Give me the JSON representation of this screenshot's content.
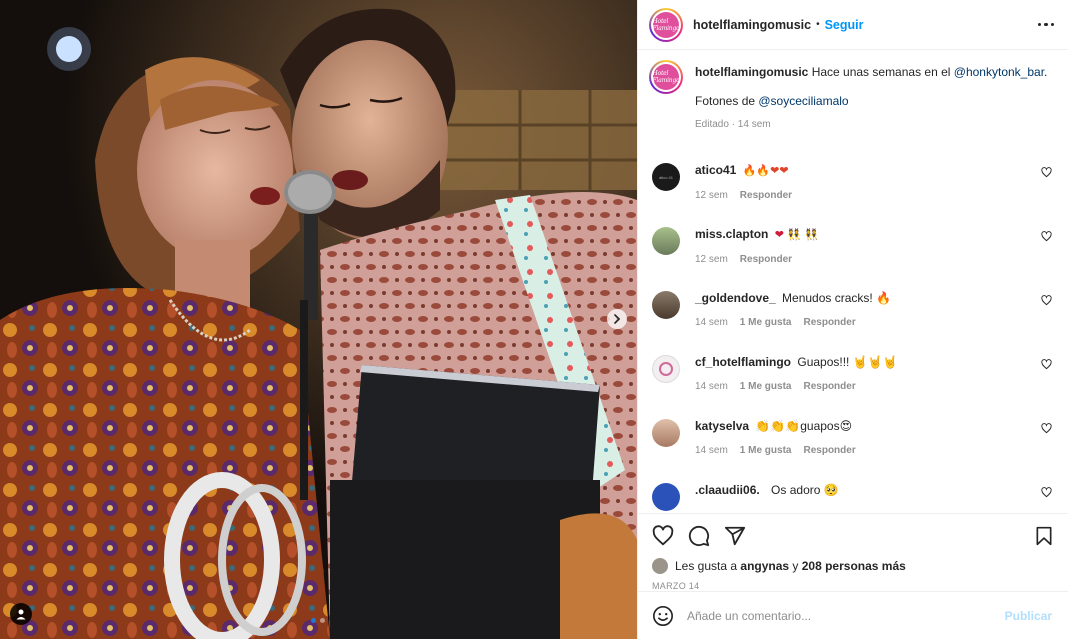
{
  "post": {
    "username": "hotelflamingomusic",
    "separator": "•",
    "follow_label": "Seguir",
    "logo_text": "Hotel Flamingo",
    "caption": {
      "user": "hotelflamingomusic",
      "text_before": "Hace unas semanas en el ",
      "mention1": "@honkytonk_bar",
      "text_after": ".",
      "line2_before": "Fotones de ",
      "mention2": "@soyceciliamalo",
      "meta": "Editado · 14 sem"
    },
    "comments": [
      {
        "user": "atico41",
        "text": "🔥🔥❤❤",
        "time": "12 sem",
        "likes": "",
        "reply": "Responder",
        "avatar_color": "#1a1a1a"
      },
      {
        "user": "miss.clapton",
        "text": "❤ 👯 👯",
        "time": "12 sem",
        "likes": "",
        "reply": "Responder",
        "avatar_color": "#7f9a70"
      },
      {
        "user": "_goldendove_",
        "text": "Menudos cracks! 🔥",
        "time": "14 sem",
        "likes": "1 Me gusta",
        "reply": "Responder",
        "avatar_color": "#6b5a4b"
      },
      {
        "user": "cf_hotelflamingo",
        "text": "Guapos!!! 🤘🤘🤘",
        "time": "14 sem",
        "likes": "1 Me gusta",
        "reply": "Responder",
        "avatar_color": "#f0e8ea"
      },
      {
        "user": "katyselva",
        "text": "👏👏👏guapos😍",
        "time": "14 sem",
        "likes": "1 Me gusta",
        "reply": "Responder",
        "avatar_color": "#c9a48e"
      },
      {
        "user": ".claaudii06.",
        "text": "Os adoro 🥺",
        "time": "",
        "likes": "",
        "reply": "",
        "avatar_color": "#2a52b8"
      }
    ],
    "likes": {
      "prefix": "Les gusta a ",
      "user": "angynas",
      "middle": " y ",
      "count": "208 personas más"
    },
    "date": "MARZO 14",
    "add_comment_placeholder": "Añade un comentario...",
    "publish_label": "Publicar"
  },
  "colors": {
    "accent": "#0095f6",
    "mention": "#00376b",
    "muted": "#8e8e8e",
    "publish_disabled": "#b2dffc"
  },
  "icons": [
    "heart-icon",
    "comment-icon",
    "share-icon",
    "bookmark-icon",
    "smile-icon",
    "more-icon",
    "chevron-right-icon",
    "user-tag-icon"
  ]
}
